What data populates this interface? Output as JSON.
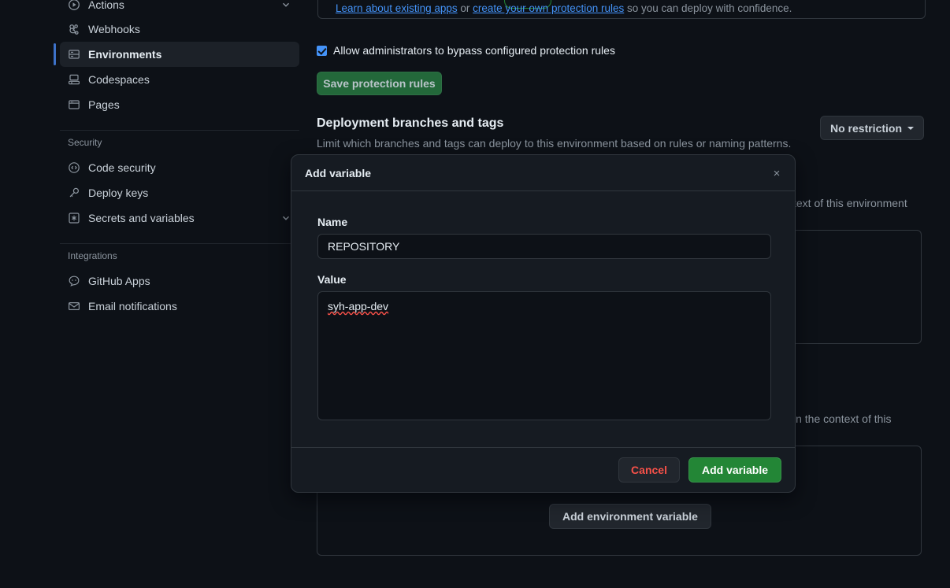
{
  "sidebar": {
    "items": [
      {
        "label": "Actions",
        "icon": "play-circle-icon",
        "chevron": true,
        "active": false
      },
      {
        "label": "Webhooks",
        "icon": "webhook-icon",
        "chevron": false,
        "active": false
      },
      {
        "label": "Environments",
        "icon": "server-icon",
        "chevron": false,
        "active": true
      },
      {
        "label": "Codespaces",
        "icon": "codespaces-icon",
        "chevron": false,
        "active": false
      },
      {
        "label": "Pages",
        "icon": "browser-icon",
        "chevron": false,
        "active": false
      }
    ],
    "security_group_title": "Security",
    "security_items": [
      {
        "label": "Code security",
        "icon": "code-shield-icon",
        "chevron": false
      },
      {
        "label": "Deploy keys",
        "icon": "key-icon",
        "chevron": false
      },
      {
        "label": "Secrets and variables",
        "icon": "asterisk-box-icon",
        "chevron": true
      }
    ],
    "integrations_group_title": "Integrations",
    "integration_items": [
      {
        "label": "GitHub Apps",
        "icon": "github-apps-icon",
        "chevron": false
      },
      {
        "label": "Email notifications",
        "icon": "mail-icon",
        "chevron": false
      }
    ]
  },
  "main": {
    "protection_note": {
      "link_1": "Learn about existing apps",
      "middle": " or ",
      "link_2": "create your own protection rules",
      "tail": " so you can deploy with confidence."
    },
    "admin_bypass_label": "Allow administrators to bypass configured protection rules",
    "save_protection_label": "Save protection rules",
    "deployment_section": {
      "title": "Deployment branches and tags",
      "subtitle": "Limit which branches and tags can deploy to this environment based on rules or naming patterns.",
      "restriction_value": "No restriction"
    },
    "background_fragments": {
      "env_text": "text of this environment",
      "context_text": "in the context of this"
    },
    "add_env_variable_label": "Add environment variable"
  },
  "modal": {
    "title": "Add variable",
    "close_icon": "×",
    "name_label": "Name",
    "name_value": "REPOSITORY",
    "value_label": "Value",
    "value_text": "syh-app-dev",
    "cancel_label": "Cancel",
    "submit_label": "Add variable"
  },
  "colors": {
    "page_bg": "#0d1117",
    "modal_bg": "#161b22",
    "border": "#30363d",
    "accent_blue": "#4493f8",
    "active_bar": "#3d72c9",
    "green_primary": "#238636",
    "green_muted": "#23683a",
    "danger_red": "#f85149",
    "text_primary": "#e6edf3",
    "text_muted": "#8b949e"
  }
}
